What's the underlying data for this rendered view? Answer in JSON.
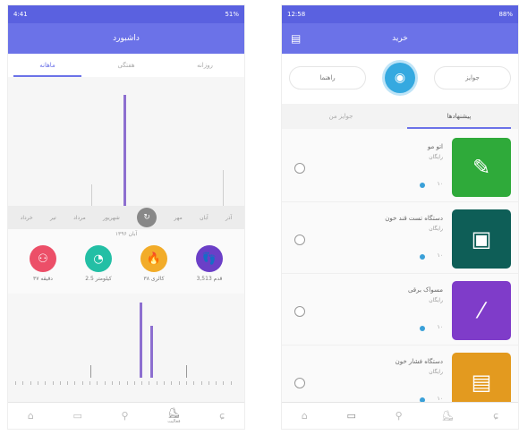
{
  "left_phone": {
    "statusbar": {
      "left": "4:41",
      "right": "51%"
    },
    "appbar": {
      "title": "داشبورد"
    },
    "tabs": [
      {
        "label": "روزانه",
        "active": false
      },
      {
        "label": "هفتگی",
        "active": false
      },
      {
        "label": "ماهانه",
        "active": true
      }
    ],
    "months": [
      "آذر",
      "آبان",
      "مهر",
      "شهریور",
      "مرداد",
      "تیر",
      "خرداد"
    ],
    "month_knob": "↻",
    "under_label": "آبان ۱۳۹۶",
    "stats": [
      {
        "label": "3,513 قدم",
        "icon": "footsteps-icon",
        "glyph": "👣",
        "color": "#6b3fc7"
      },
      {
        "label": "۳۸ کالری",
        "icon": "fire-icon",
        "glyph": "🔥",
        "color": "#f2ac29"
      },
      {
        "label": "2.5 کیلومتر",
        "icon": "speed-icon",
        "glyph": "◔",
        "color": "#23bfa5"
      },
      {
        "label": "۳۷ دقیقه",
        "icon": "chart-icon",
        "glyph": "⚇",
        "color": "#ec4f68"
      }
    ],
    "nav": [
      {
        "icon": "shoe-icon",
        "glyph": "⌂",
        "active": false
      },
      {
        "icon": "card-icon",
        "glyph": "▭",
        "active": false
      },
      {
        "icon": "footprint-icon",
        "glyph": "⚲",
        "active": false
      },
      {
        "icon": "sneaker-icon",
        "glyph": "⛸",
        "active": true,
        "sub": "فعالیت"
      },
      {
        "icon": "apple-icon",
        "glyph": "ɕ",
        "active": false
      }
    ]
  },
  "right_phone": {
    "statusbar": {
      "left": "12:58",
      "right": "88%"
    },
    "appbar": {
      "title": "خرید",
      "left_icon": "▤"
    },
    "pills": {
      "left": "جوایز",
      "right": "راهنما"
    },
    "avatar_glyph": "◉",
    "tabs": [
      {
        "label": "پیشنهادها",
        "active": true
      },
      {
        "label": "جوایز من",
        "active": false
      }
    ],
    "items": [
      {
        "title": "اتو مو",
        "sub": "رایگان",
        "qty": "۱۰",
        "icon": "hair-iron-icon",
        "glyph": "✎",
        "color": "#2faa3a"
      },
      {
        "title": "دستگاه تست قند خون",
        "sub": "رایگان",
        "qty": "۱۰",
        "icon": "glucometer-icon",
        "glyph": "▣",
        "color": "#0e5e57"
      },
      {
        "title": "مسواک برقی",
        "sub": "رایگان",
        "qty": "۱۰",
        "icon": "toothbrush-icon",
        "glyph": "⁄",
        "color": "#7f3cc9"
      },
      {
        "title": "دستگاه فشار خون",
        "sub": "رایگان",
        "qty": "۱۰",
        "icon": "bp-monitor-icon",
        "glyph": "▤",
        "color": "#e39a1f"
      }
    ],
    "nav": [
      {
        "icon": "shoe-icon",
        "glyph": "⌂",
        "active": false
      },
      {
        "icon": "card-icon",
        "glyph": "▭",
        "active": true
      },
      {
        "icon": "footprint-icon",
        "glyph": "⚲",
        "active": false
      },
      {
        "icon": "sneaker-icon",
        "glyph": "⛸",
        "active": false
      },
      {
        "icon": "apple-icon",
        "glyph": "ɕ",
        "active": false
      }
    ]
  },
  "colors": {
    "accent": "#6b72e8",
    "status": "#5a61e0"
  }
}
